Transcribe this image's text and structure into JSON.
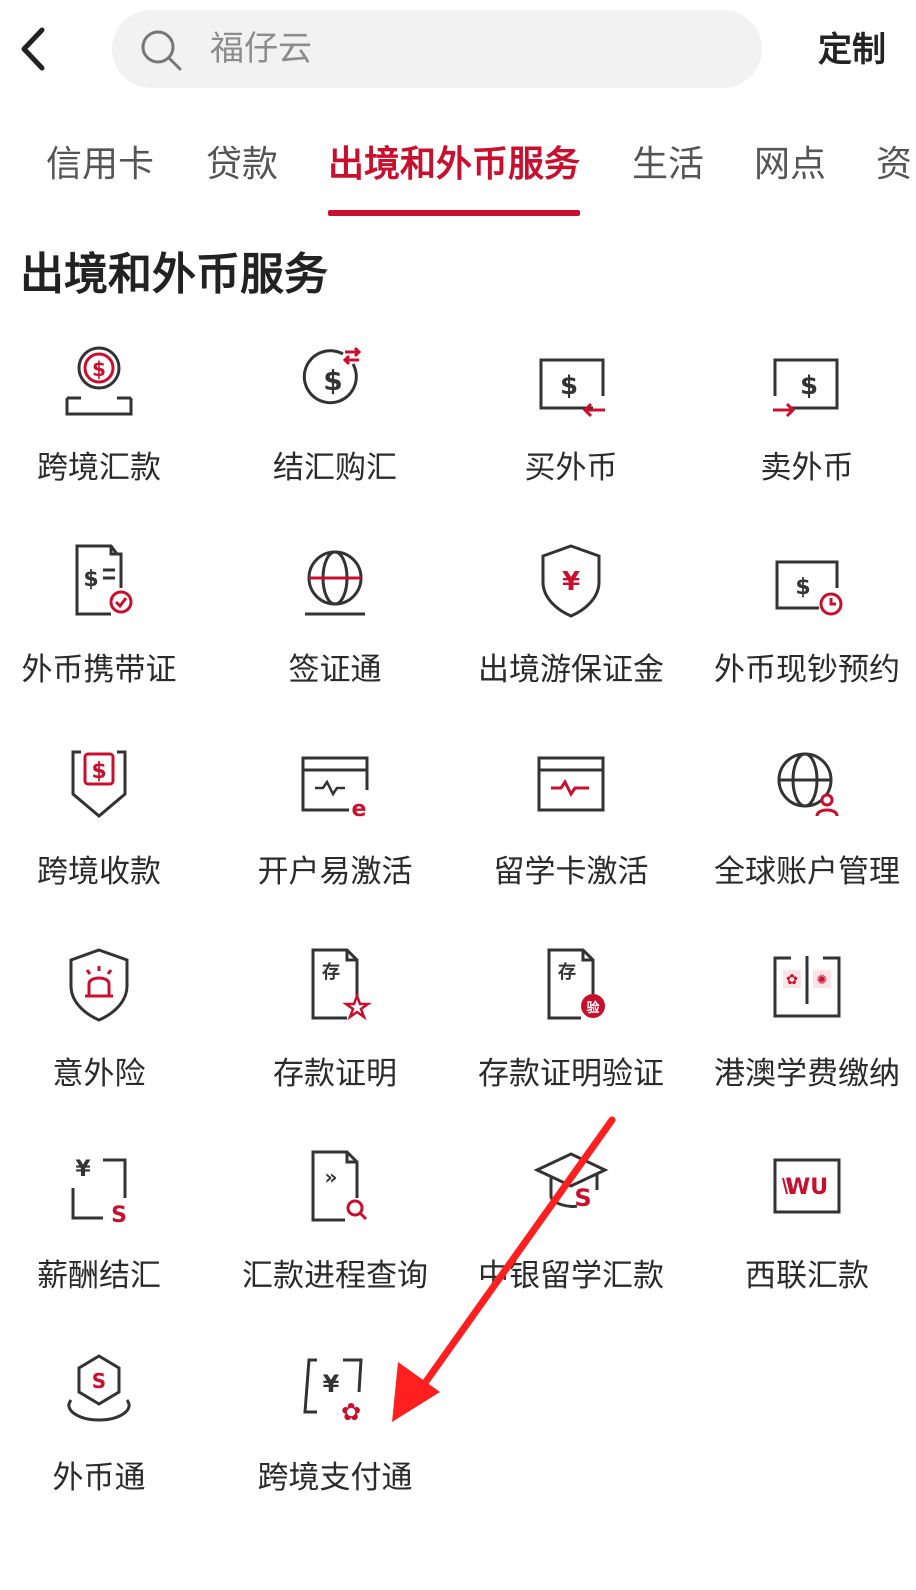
{
  "header": {
    "search_placeholder": "福仔云",
    "custom_label": "定制"
  },
  "tabs": [
    {
      "label": "信用卡",
      "active": false
    },
    {
      "label": "贷款",
      "active": false
    },
    {
      "label": "出境和外币服务",
      "active": true
    },
    {
      "label": "生活",
      "active": false
    },
    {
      "label": "网点",
      "active": false
    },
    {
      "label": "资",
      "active": false
    }
  ],
  "section": {
    "title": "出境和外币服务"
  },
  "services": [
    {
      "label": "跨境汇款",
      "icon": "dollar-coin-icon"
    },
    {
      "label": "结汇购汇",
      "icon": "currency-exchange-icon"
    },
    {
      "label": "买外币",
      "icon": "buy-foreign-currency-icon"
    },
    {
      "label": "卖外币",
      "icon": "sell-foreign-currency-icon"
    },
    {
      "label": "外币携带证",
      "icon": "currency-certificate-icon"
    },
    {
      "label": "签证通",
      "icon": "globe-visa-icon"
    },
    {
      "label": "出境游保证金",
      "icon": "yuan-shield-icon"
    },
    {
      "label": "外币现钞预约",
      "icon": "cash-clock-icon"
    },
    {
      "label": "跨境收款",
      "icon": "receive-payment-icon"
    },
    {
      "label": "开户易激活",
      "icon": "card-e-icon"
    },
    {
      "label": "留学卡激活",
      "icon": "card-pulse-icon"
    },
    {
      "label": "全球账户管理",
      "icon": "globe-user-icon"
    },
    {
      "label": "意外险",
      "icon": "alarm-shield-icon"
    },
    {
      "label": "存款证明",
      "icon": "deposit-certificate-star-icon"
    },
    {
      "label": "存款证明验证",
      "icon": "deposit-certificate-verify-icon"
    },
    {
      "label": "港澳学费缴纳",
      "icon": "hk-macao-book-icon"
    },
    {
      "label": "薪酬结汇",
      "icon": "salary-exchange-icon"
    },
    {
      "label": "汇款进程查询",
      "icon": "remittance-search-icon"
    },
    {
      "label": "中银留学汇款",
      "icon": "graduation-cap-icon"
    },
    {
      "label": "西联汇款",
      "icon": "western-union-icon"
    },
    {
      "label": "外币通",
      "icon": "foreign-currency-platform-icon"
    },
    {
      "label": "跨境支付通",
      "icon": "cross-border-payment-icon"
    }
  ],
  "colors": {
    "accent": "#c8102e",
    "icon_stroke": "#333333",
    "annotation_arrow": "#ff1f1f"
  }
}
